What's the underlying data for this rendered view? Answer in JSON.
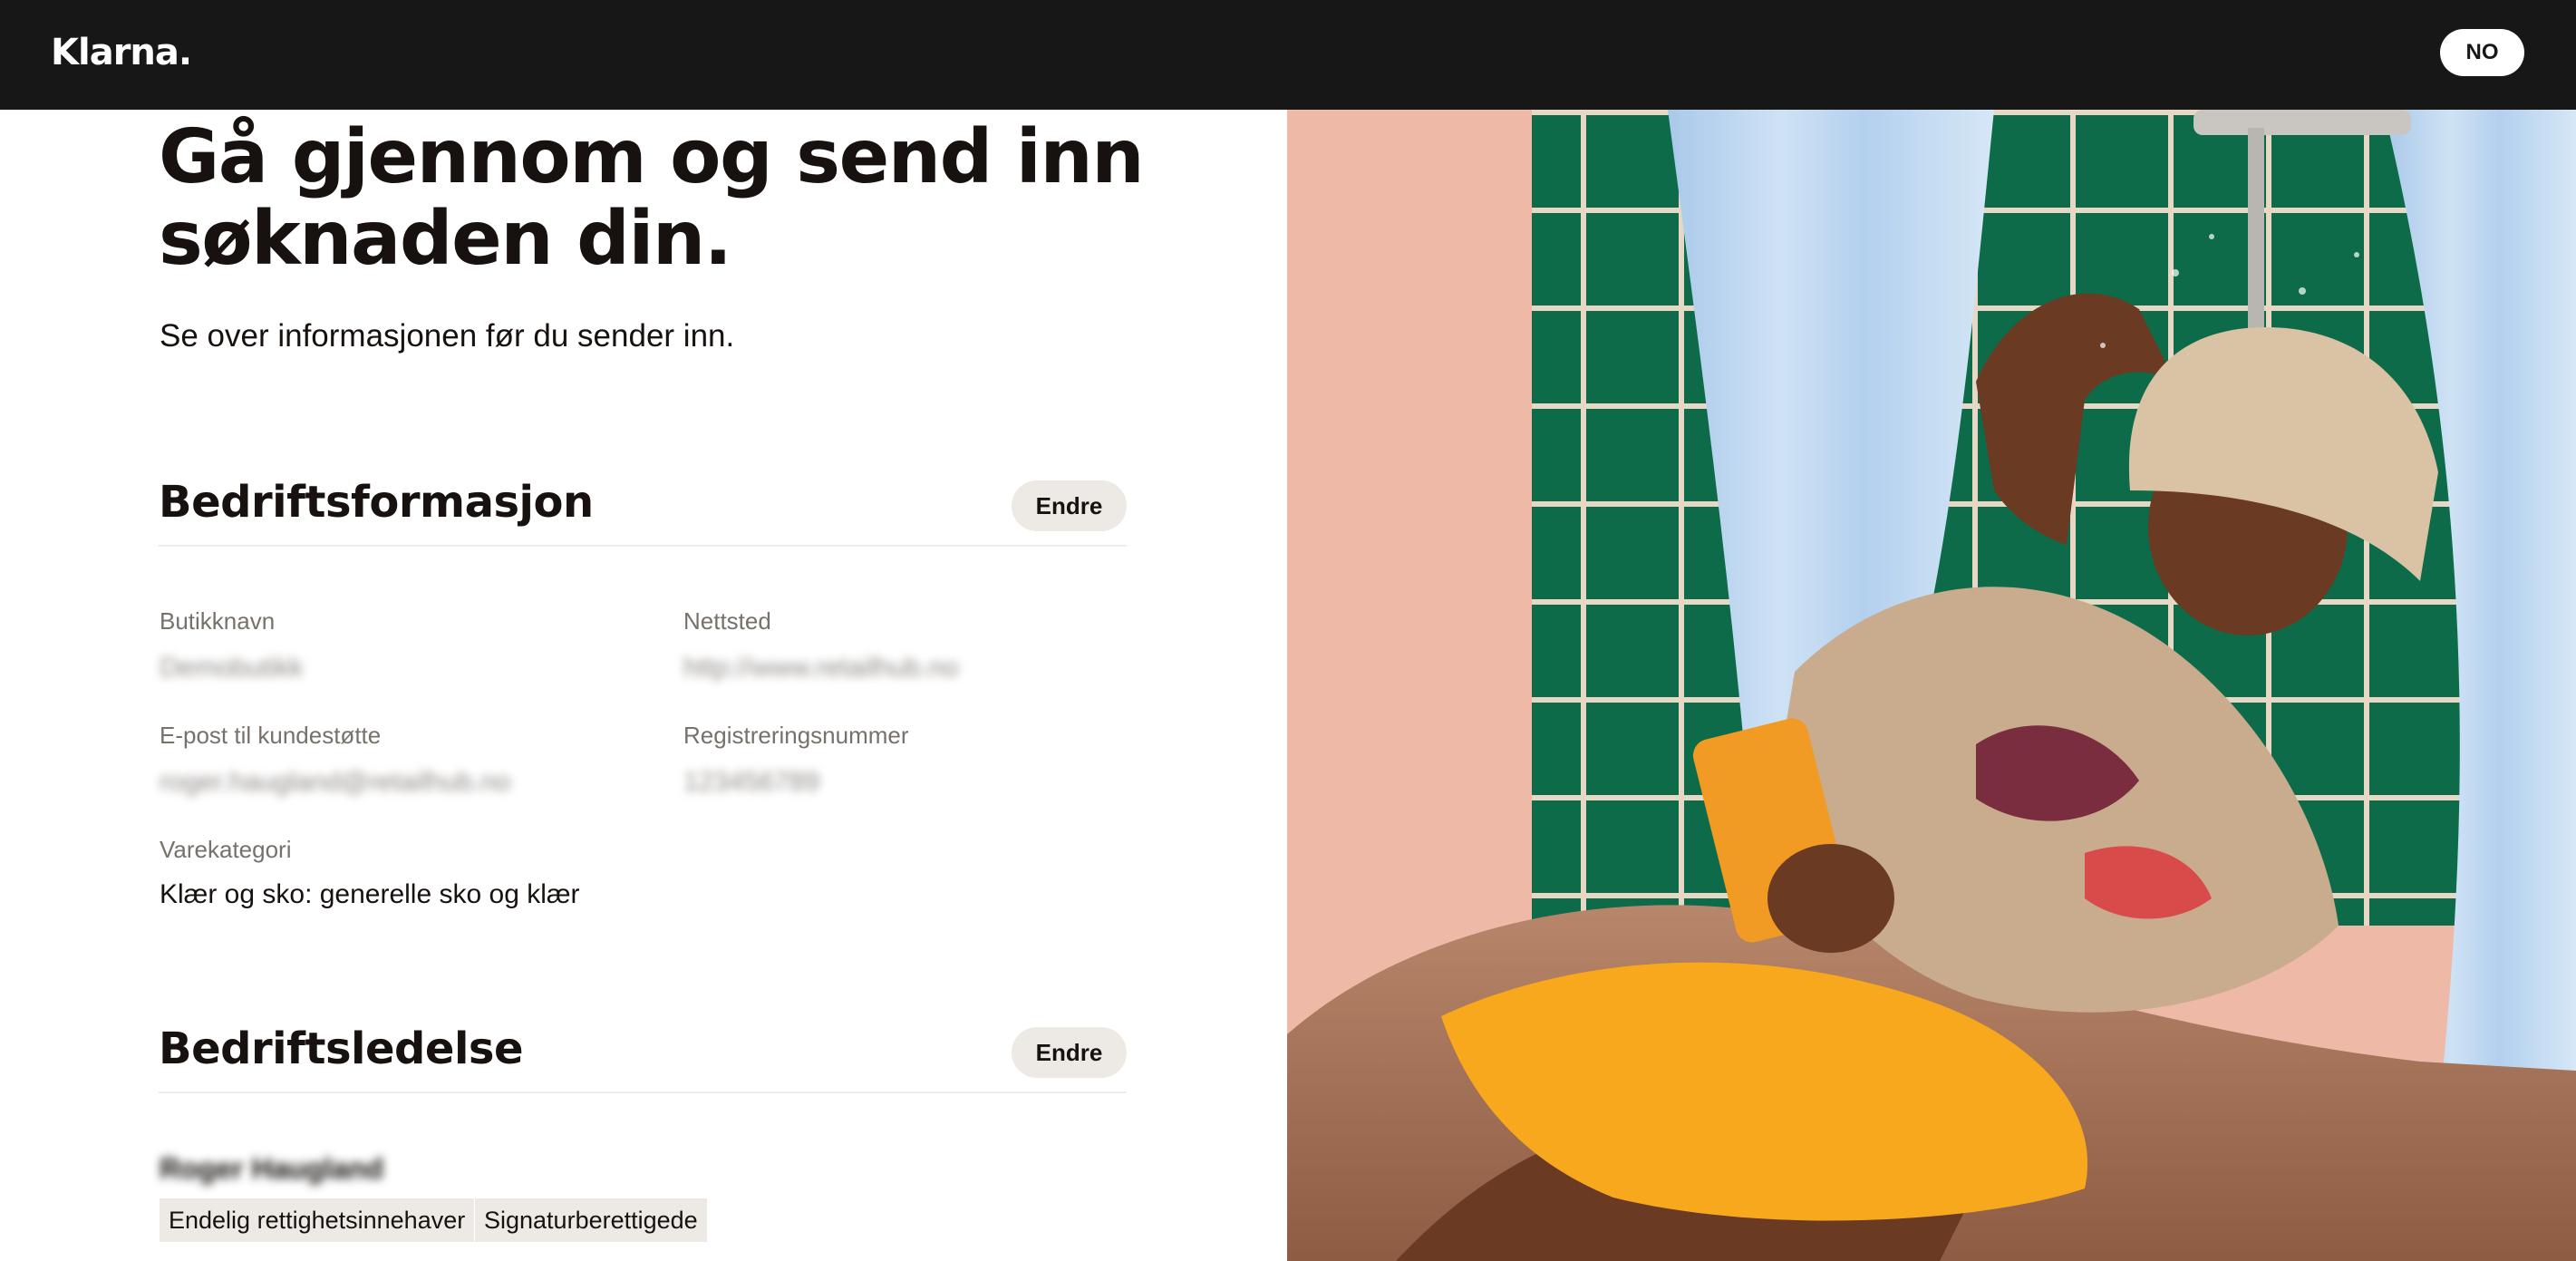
{
  "header": {
    "logo_text": "Klarna.",
    "language_button": "NO"
  },
  "page": {
    "title_line1": "Gå gjennom og send inn",
    "title_line2": "søknaden din.",
    "subtitle": "Se over informasjonen før du sender inn."
  },
  "business_info": {
    "heading": "Bedriftsformasjon",
    "edit_label": "Endre",
    "fields": [
      {
        "label": "Butikknavn",
        "value": "Demobutikk"
      },
      {
        "label": "Nettsted",
        "value": "http://www.retailhub.no"
      },
      {
        "label": "E-post til kundestøtte",
        "value": "roger.haugland@retailhub.no"
      },
      {
        "label": "Registreringsnummer",
        "value": "123456789"
      },
      {
        "label": "Varekategori",
        "value": "Klær og sko: generelle sko og klær"
      }
    ]
  },
  "management": {
    "heading": "Bedriftsledelse",
    "edit_label": "Endre",
    "person_name": "Roger Haugland",
    "roles": [
      "Endelig rettighetsinnehaver",
      "Signaturberettigede"
    ]
  },
  "photo": {
    "subject": "person in bucket hat and yellow shorts relaxing in a bathtub under a shower holding a phone"
  },
  "colors": {
    "header_bg": "#171717",
    "button_bg": "#ede9e4",
    "tile_green": "#0d6b49",
    "wall_pink": "#efb9a8",
    "curtain_blue": "#b9d4ee",
    "shorts_yellow": "#f7a81c"
  }
}
